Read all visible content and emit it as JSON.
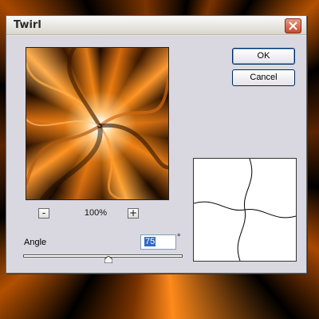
{
  "dialog": {
    "title": "Twirl",
    "buttons": {
      "ok_label": "OK",
      "cancel_label": "Cancel"
    },
    "zoom": {
      "minus_label": "-",
      "plus_label": "+",
      "level": "100%"
    },
    "angle": {
      "label": "Angle",
      "value": "75",
      "unit": "°",
      "slider_fraction": 0.55
    }
  },
  "colors": {
    "accent": "#ff8a1a",
    "dialog_bg": "#ece9d8",
    "client_bg": "#d9d8e0",
    "close_red": "#c44a2f"
  },
  "icons": {
    "close": "close-icon",
    "zoom_out": "minus-icon",
    "zoom_in": "plus-icon"
  }
}
